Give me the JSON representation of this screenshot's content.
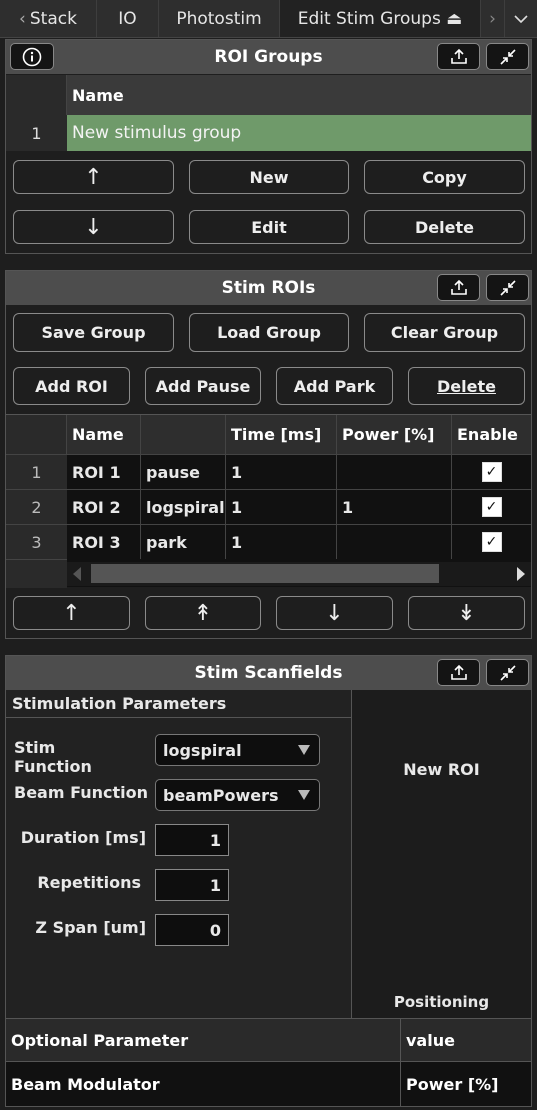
{
  "tabs": [
    {
      "label": "Stack"
    },
    {
      "label": "IO"
    },
    {
      "label": "Photostim"
    },
    {
      "label": "Edit Stim Groups ⏏"
    }
  ],
  "roi_groups": {
    "title": "ROI Groups",
    "col_name": "Name",
    "rows": [
      {
        "index": "1",
        "name": "New stimulus group"
      }
    ],
    "buttons": {
      "up": "↑",
      "new": "New",
      "copy": "Copy",
      "down": "↓",
      "edit": "Edit",
      "delete": "Delete"
    }
  },
  "stim_rois": {
    "title": "Stim ROIs",
    "buttons": {
      "save_group": "Save Group",
      "load_group": "Load Group",
      "clear_group": "Clear Group",
      "add_roi": "Add ROI",
      "add_pause": "Add Pause",
      "add_park": "Add Park",
      "delete": "Delete"
    },
    "columns": {
      "name": "Name",
      "type": "",
      "time": "Time [ms]",
      "power": "Power [%]",
      "enable": "Enable"
    },
    "rows": [
      {
        "index": "1",
        "name": "ROI 1",
        "type": "pause",
        "time": "1",
        "power": "",
        "enabled": true
      },
      {
        "index": "2",
        "name": "ROI 2",
        "type": "logspiral",
        "time": "1",
        "power": "1",
        "enabled": true
      },
      {
        "index": "3",
        "name": "ROI 3",
        "type": "park",
        "time": "1",
        "power": "",
        "enabled": true
      }
    ],
    "move_buttons": {
      "up": "↑",
      "top": "↟",
      "down": "↓",
      "bottom": "↡"
    }
  },
  "stim_scanfields": {
    "title": "Stim Scanfields",
    "params_title": "Stimulation Parameters",
    "stim_function_label": "Stim Function",
    "stim_function_value": "logspiral",
    "beam_function_label": "Beam Function",
    "beam_function_value": "beamPowers",
    "duration_label": "Duration [ms]",
    "duration_value": "1",
    "repetitions_label": "Repetitions",
    "repetitions_value": "1",
    "zspan_label": "Z Span [um]",
    "zspan_value": "0",
    "preview_title": "New ROI",
    "positioning": "Positioning",
    "optional_header": "Optional Parameter",
    "value_header": "value",
    "beam_modulator": "Beam Modulator",
    "beam_power": "Power [%]"
  }
}
